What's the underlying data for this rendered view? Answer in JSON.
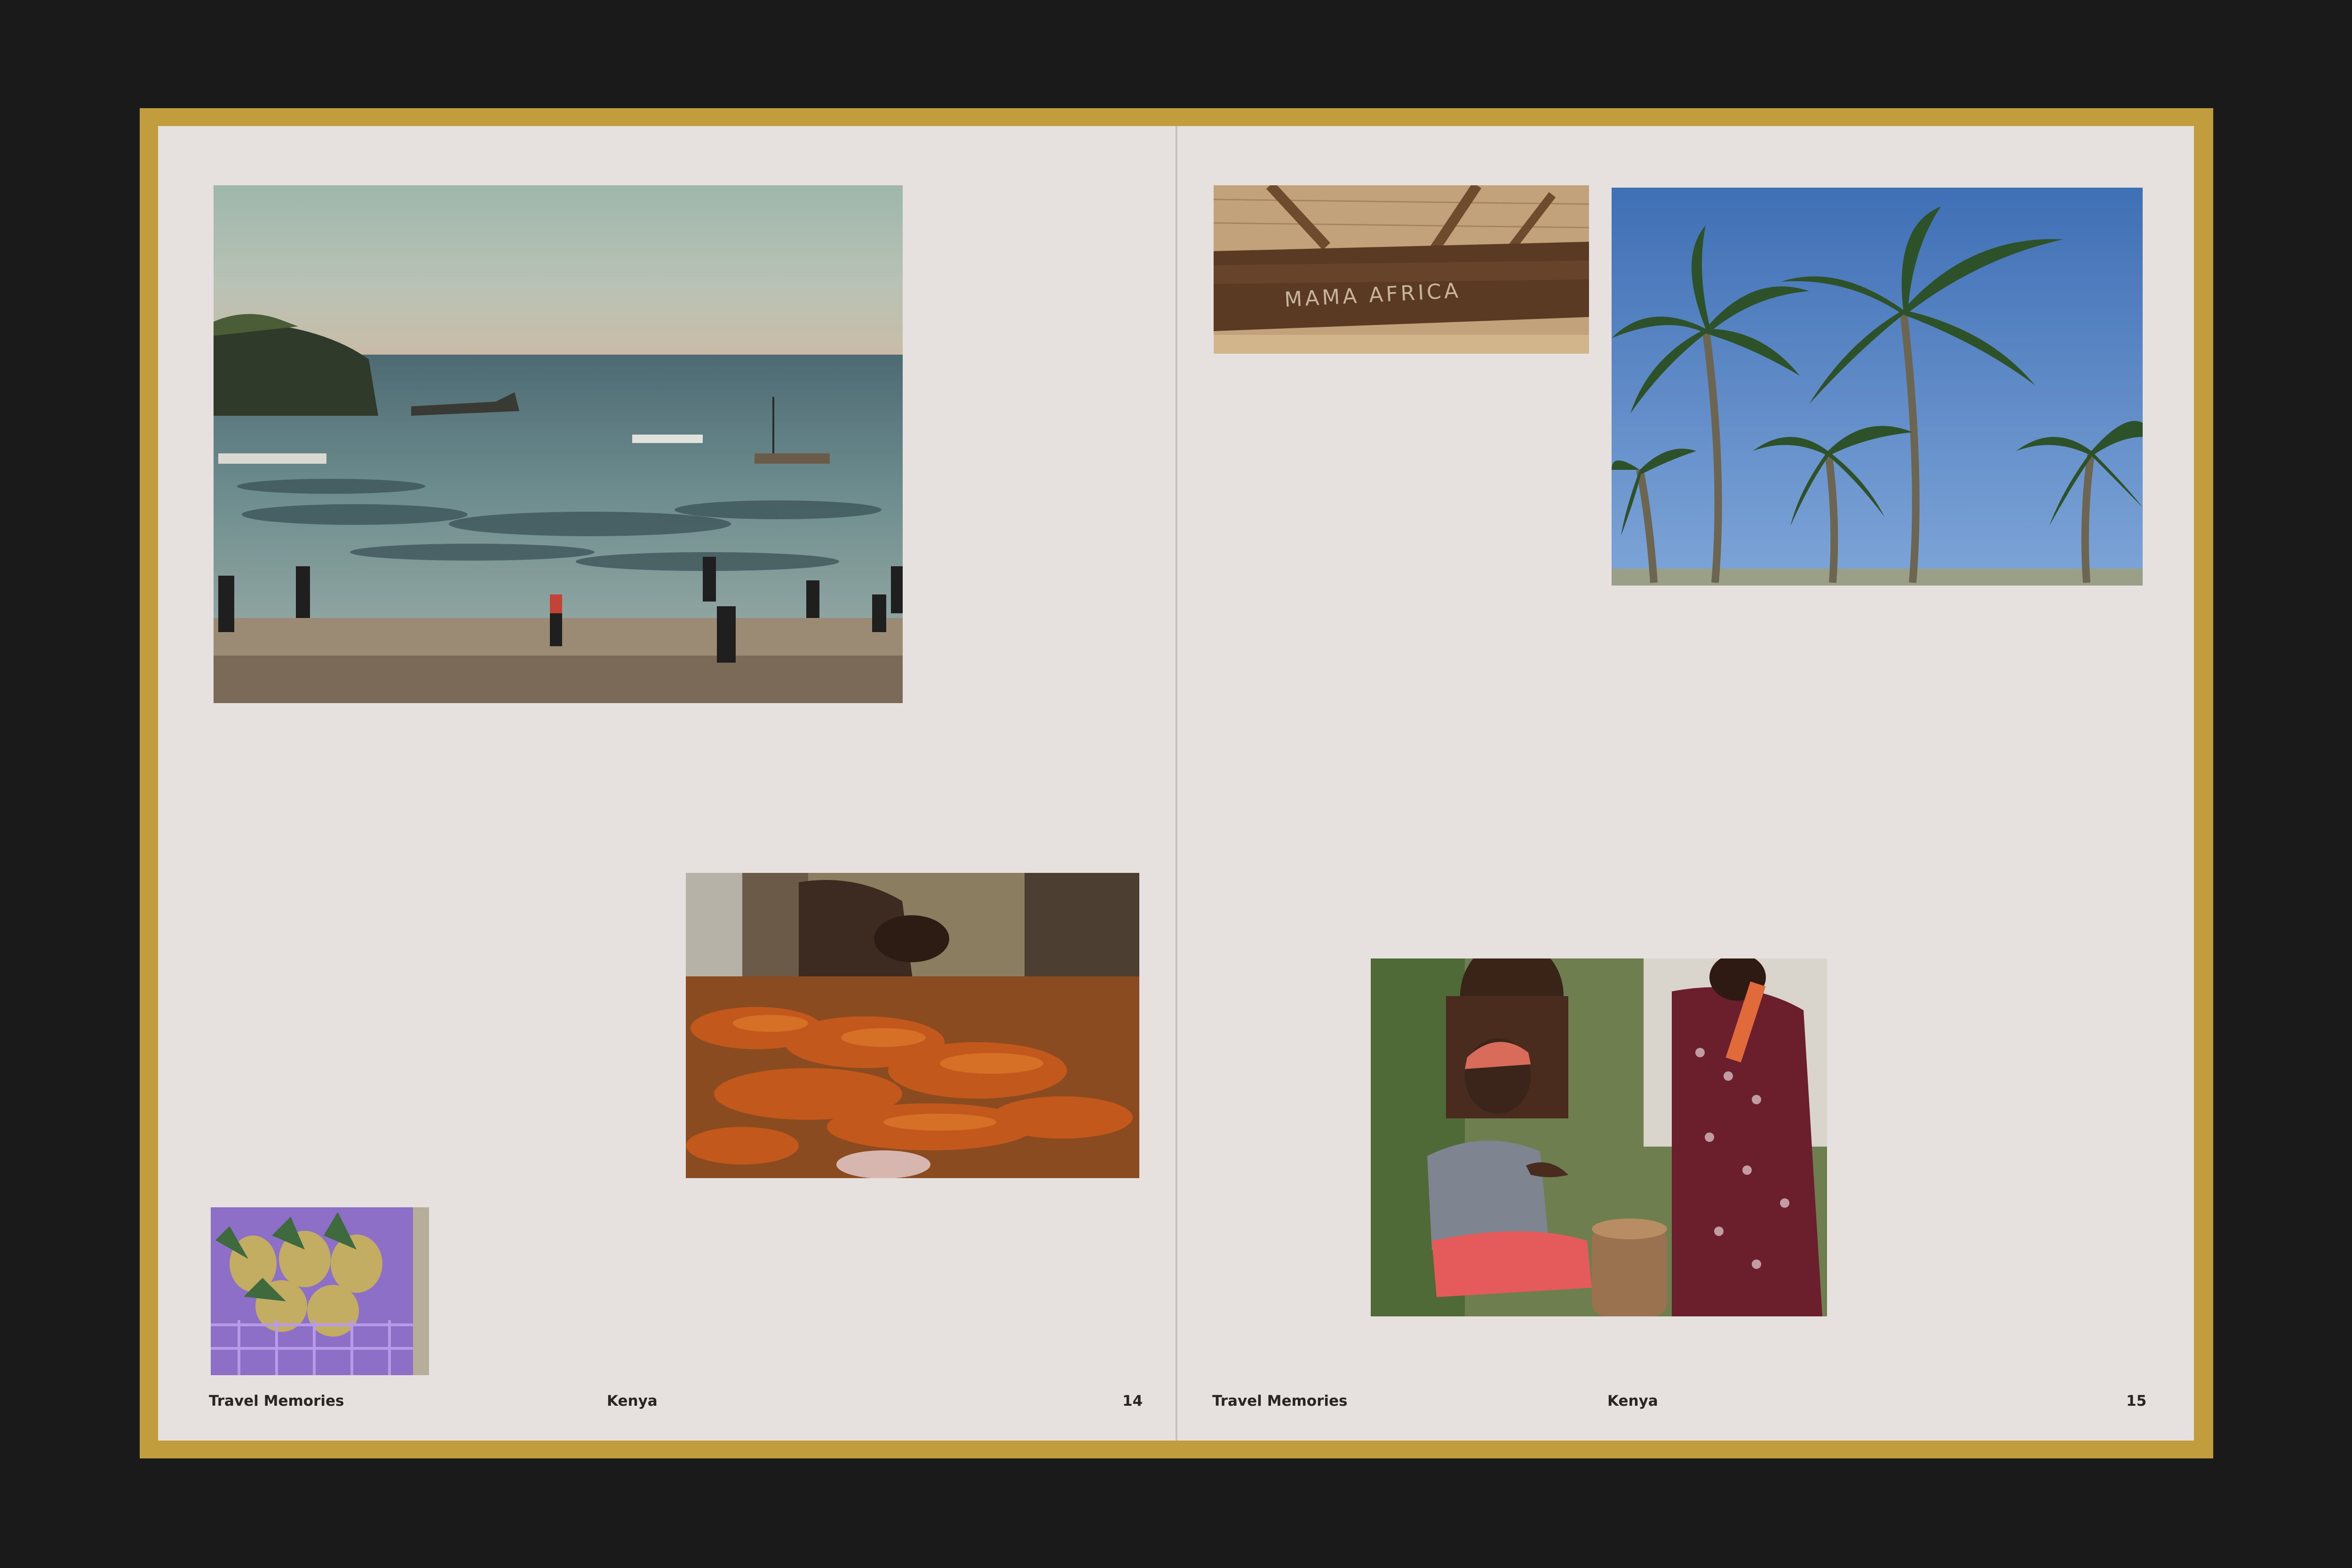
{
  "left_page": {
    "running_title": "Travel Memories",
    "section": "Kenya",
    "page_number": "14",
    "photos": [
      "beach-at-low-tide",
      "grilled-lobsters",
      "pineapple-crate"
    ]
  },
  "right_page": {
    "running_title": "Travel Memories",
    "section": "Kenya",
    "page_number": "15",
    "photos": [
      "mama-africa-sign",
      "palm-trees",
      "drummer-and-dancers"
    ],
    "sign_text": "MAMA AFRICA"
  },
  "colors": {
    "background": "#1a1a1a",
    "frame": "#c19d3e",
    "paper": "#e6e1de",
    "text": "#2a2523"
  }
}
